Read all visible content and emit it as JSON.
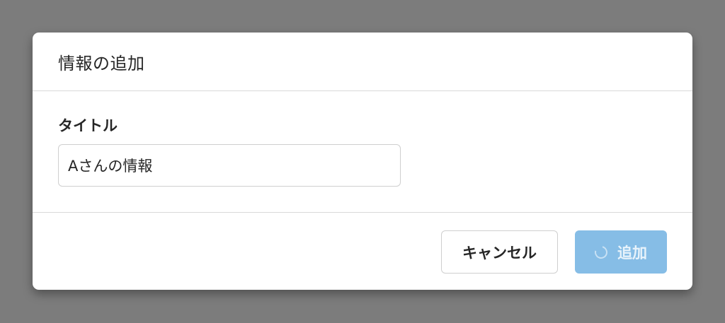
{
  "dialog": {
    "title": "情報の追加"
  },
  "form": {
    "title_field": {
      "label": "タイトル",
      "value": "Aさんの情報"
    }
  },
  "footer": {
    "cancel_label": "キャンセル",
    "submit_label": "追加",
    "submit_state": "loading"
  },
  "colors": {
    "overlay": "#7c7c7c",
    "primary_disabled": "#86bde6"
  },
  "icons": {
    "submit_spinner": "loading-spinner-icon"
  }
}
